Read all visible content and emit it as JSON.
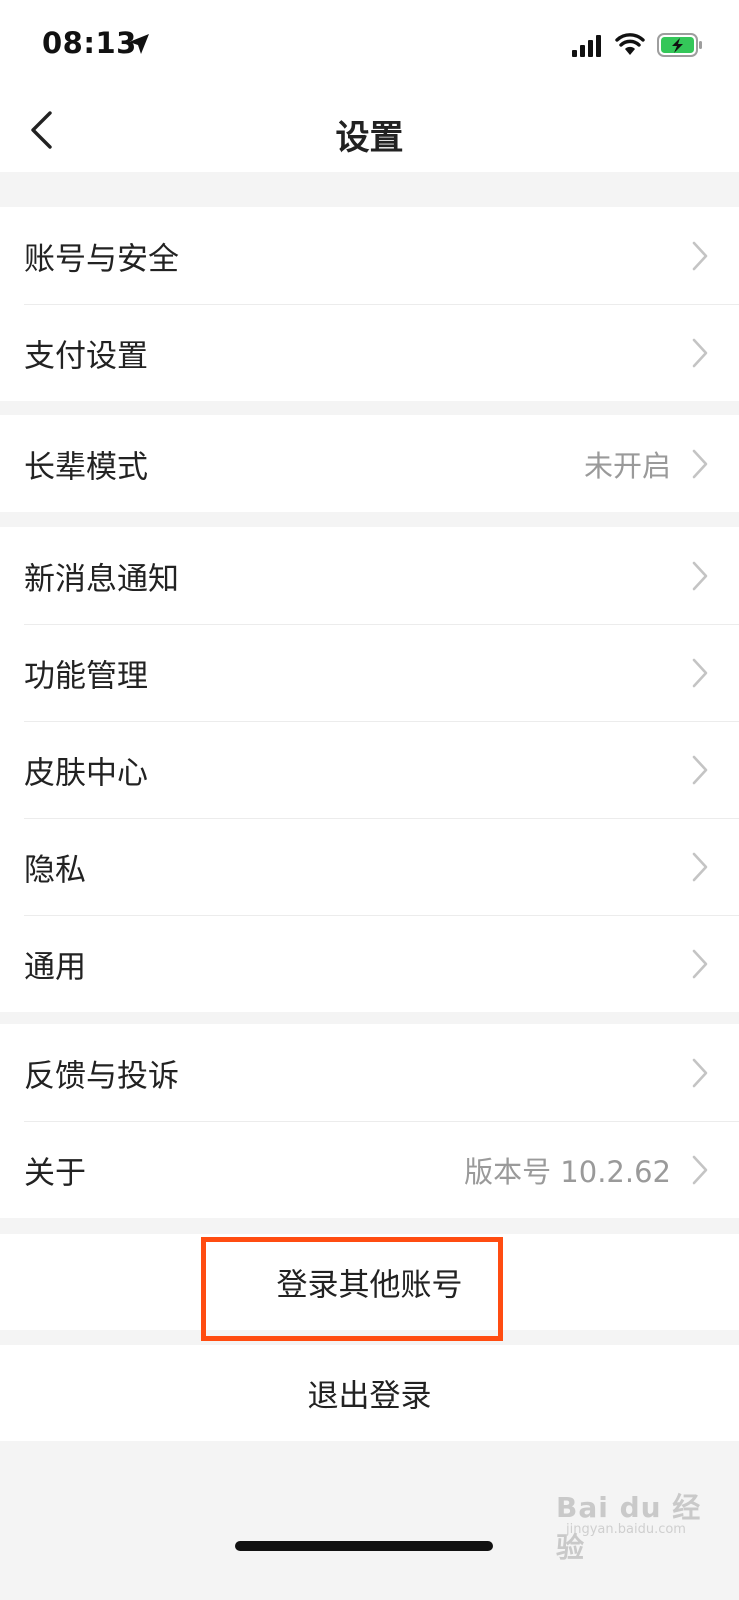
{
  "status_bar": {
    "time": "08:13",
    "icons": [
      "location-arrow-icon",
      "cellular-signal-icon",
      "wifi-icon",
      "battery-charging-icon"
    ]
  },
  "nav": {
    "back_icon": "chevron-left-icon",
    "title": "设置"
  },
  "groups": [
    {
      "items": [
        {
          "label": "账号与安全",
          "value": ""
        },
        {
          "label": "支付设置",
          "value": ""
        }
      ]
    },
    {
      "items": [
        {
          "label": "长辈模式",
          "value": "未开启"
        }
      ]
    },
    {
      "items": [
        {
          "label": "新消息通知",
          "value": ""
        },
        {
          "label": "功能管理",
          "value": ""
        },
        {
          "label": "皮肤中心",
          "value": ""
        },
        {
          "label": "隐私",
          "value": ""
        },
        {
          "label": "通用",
          "value": ""
        }
      ]
    },
    {
      "items": [
        {
          "label": "反馈与投诉",
          "value": ""
        },
        {
          "label": "关于",
          "value": "版本号 10.2.62"
        }
      ]
    }
  ],
  "actions": {
    "switch_account": "登录其他账号",
    "logout": "退出登录"
  },
  "colors": {
    "highlight_border": "#ff4c11",
    "battery_fill": "#34c759",
    "secondary_text": "#9a9a9a",
    "background": "#f4f4f4"
  },
  "watermark": {
    "logo": "Bai du 经验",
    "url": "jingyan.baidu.com"
  }
}
